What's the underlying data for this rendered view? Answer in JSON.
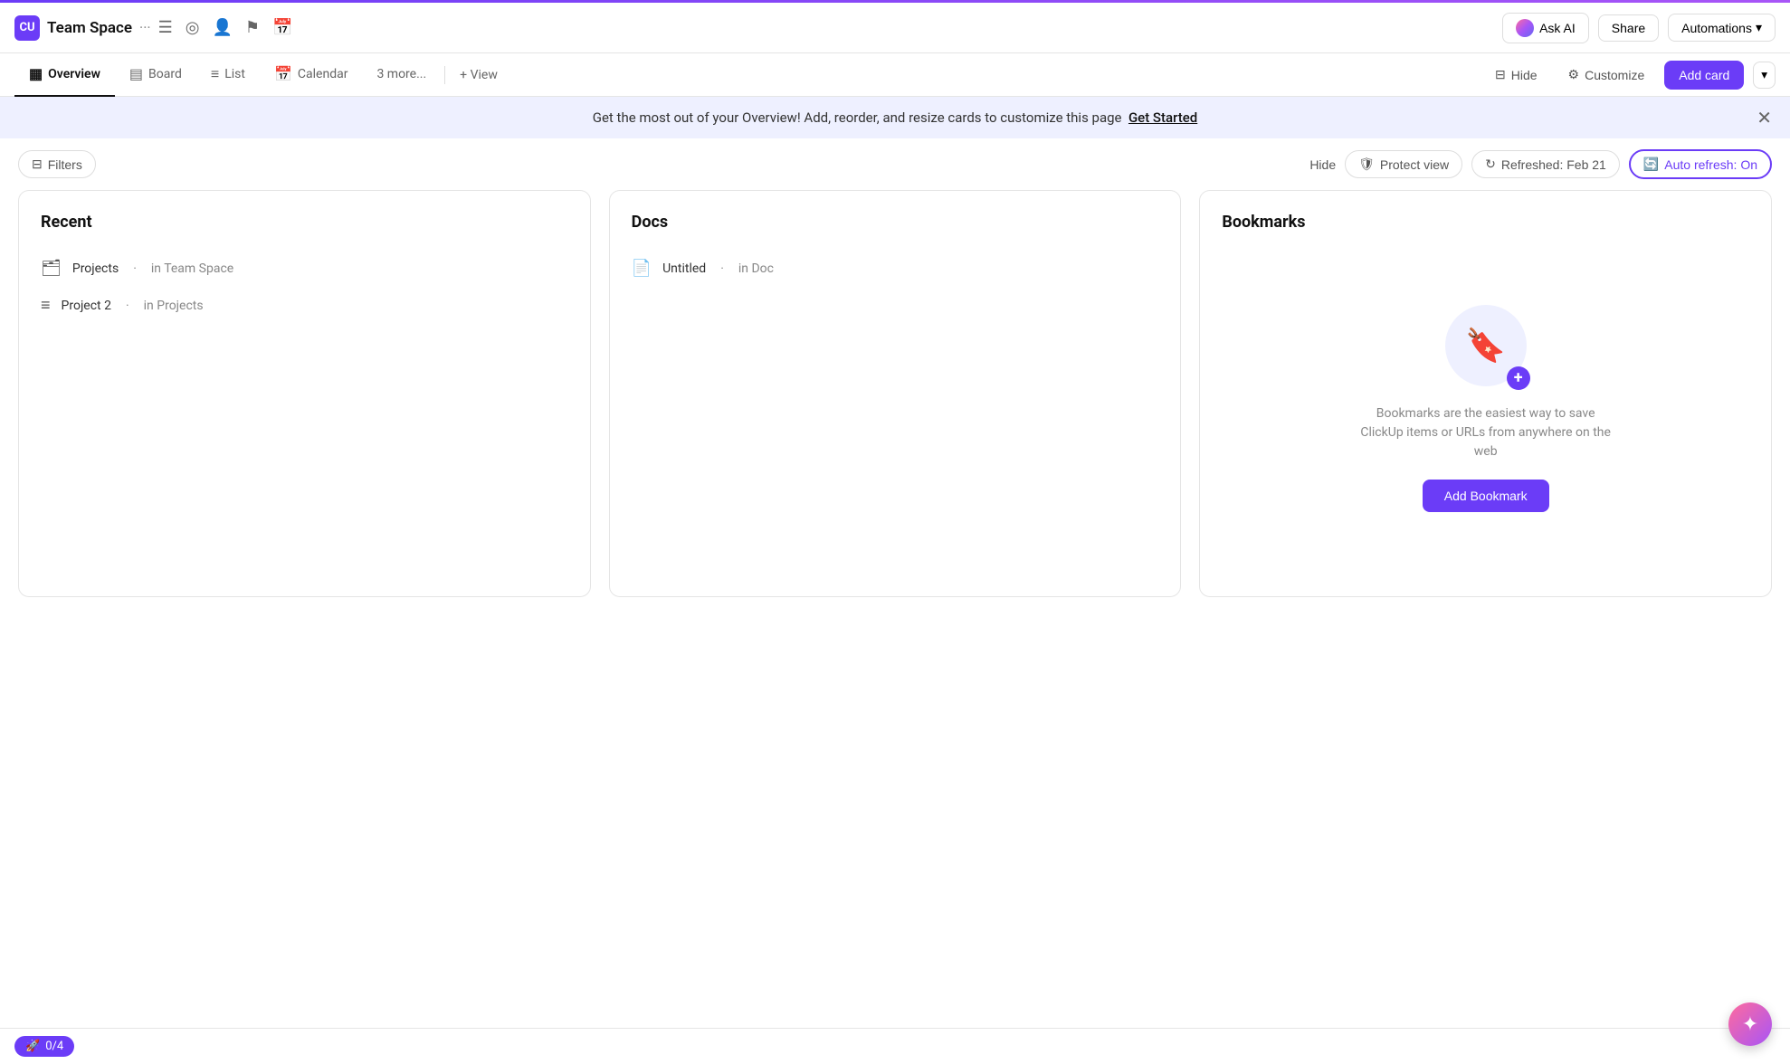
{
  "accent_bar": {},
  "top_nav": {
    "logo_text": "CU",
    "title": "Team Space",
    "dots": "···",
    "icons": [
      "☰",
      "◎",
      "👤",
      "⚑",
      "📅"
    ],
    "ask_ai_label": "Ask AI",
    "share_label": "Share",
    "automations_label": "Automations"
  },
  "tab_bar": {
    "tabs": [
      {
        "id": "overview",
        "icon": "▦",
        "label": "Overview",
        "active": true
      },
      {
        "id": "board",
        "icon": "▤",
        "label": "Board",
        "active": false
      },
      {
        "id": "list",
        "icon": "≡",
        "label": "List",
        "active": false
      },
      {
        "id": "calendar",
        "icon": "📅",
        "label": "Calendar",
        "active": false
      },
      {
        "id": "more",
        "icon": "",
        "label": "3 more...",
        "active": false
      }
    ],
    "add_view_label": "+ View",
    "hide_label": "Hide",
    "customize_label": "Customize",
    "add_card_label": "Add card"
  },
  "banner": {
    "text": "Get the most out of your Overview! Add, reorder, and resize cards to customize this page",
    "link_label": "Get Started"
  },
  "toolbar": {
    "filters_label": "Filters",
    "hide_label": "Hide",
    "protect_view_label": "Protect view",
    "refreshed_label": "Refreshed: Feb 21",
    "auto_refresh_label": "Auto refresh: On"
  },
  "cards": {
    "recent": {
      "title": "Recent",
      "items": [
        {
          "icon": "🗂",
          "name": "Projects",
          "dot": "·",
          "location": "in Team Space"
        },
        {
          "icon": "≡",
          "name": "Project 2",
          "dot": "·",
          "location": "in Projects"
        }
      ]
    },
    "docs": {
      "title": "Docs",
      "items": [
        {
          "icon": "📄",
          "name": "Untitled",
          "dot": "·",
          "location": "in Doc"
        }
      ]
    },
    "bookmarks": {
      "title": "Bookmarks",
      "description": "Bookmarks are the easiest way to save ClickUp items or URLs from anywhere on the web",
      "add_bookmark_label": "Add Bookmark"
    }
  },
  "bottom_bar": {
    "rocket_label": "0/4"
  }
}
